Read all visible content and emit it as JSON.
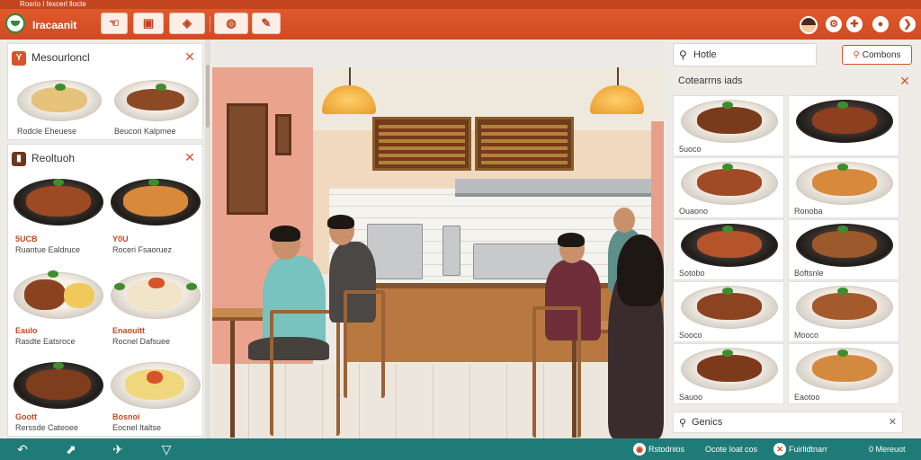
{
  "window": {
    "title": "Rosrio l fexcerl llocte"
  },
  "toolbar": {
    "app_title": "Iracaanit",
    "buttons": [
      {
        "name": "toolbar-btn-1",
        "icon": "hand-icon",
        "glyph": "☜"
      },
      {
        "name": "toolbar-btn-2",
        "icon": "receipt-icon",
        "glyph": "▣"
      },
      {
        "name": "toolbar-btn-3",
        "icon": "tag-icon",
        "glyph": "◈"
      },
      {
        "name": "toolbar-btn-4",
        "icon": "bowl-icon",
        "glyph": "◍"
      },
      {
        "name": "toolbar-btn-5",
        "icon": "edit-icon",
        "glyph": "✎"
      }
    ],
    "right_icons": [
      {
        "name": "settings-round-button",
        "icon": "gear-icon",
        "glyph": "⚙"
      },
      {
        "name": "info-round-button",
        "icon": "plus-icon",
        "glyph": "✚"
      },
      {
        "name": "alerts-round-button",
        "icon": "bell-icon",
        "glyph": "●"
      },
      {
        "name": "next-round-button",
        "icon": "arrow-right-icon",
        "glyph": "❯"
      }
    ]
  },
  "left_panel": {
    "top_card": {
      "title": "Mesourloncl",
      "icon_glyph": "Y",
      "items": [
        {
          "name": "Rodcle Eheuese",
          "food": "#e6c27a"
        },
        {
          "name": "Beucori Kalpmee",
          "food": "#8b4a23"
        }
      ]
    },
    "main_card": {
      "title": "Reoltuoh",
      "items": [
        {
          "price": "5UCB",
          "name": "Ruantue Ealdruce",
          "food": "#9b4a22",
          "plate": "dark"
        },
        {
          "price": "Y0U",
          "name": "Roceri Fsaoruez",
          "food": "#d88a3a",
          "plate": "dark"
        },
        {
          "price": "Eaulo",
          "name": "Rasdte Eatsroce",
          "food": "#8a4320",
          "plate": "light"
        },
        {
          "price": "Enaouitt",
          "name": "Rocnel Dafsuee",
          "food": "#f1e4c8",
          "plate": "light"
        },
        {
          "price": "Goott",
          "name": "Rerssde Cateoee",
          "food": "#7e3d1d",
          "plate": "dark"
        },
        {
          "price": "Bosnoi",
          "name": "Eocnel Italtse",
          "food": "#f0d77e",
          "plate": "light"
        }
      ]
    }
  },
  "right_panel": {
    "search": {
      "value": "Hotle"
    },
    "search_button": "Combons",
    "card_title": "Cotearrns iads",
    "items": [
      {
        "price": "5uoco",
        "food": "#7a3b1c",
        "plate": "light"
      },
      {
        "price": "",
        "food": "#8d3f1f",
        "plate": "dark"
      },
      {
        "price": "Ouaono",
        "food": "#a04b24",
        "plate": "light"
      },
      {
        "price": "Ronoba",
        "food": "#d78a3b",
        "plate": "light"
      },
      {
        "price": "Sotobo",
        "food": "#b5532a",
        "plate": "dark"
      },
      {
        "price": "Boftsnle",
        "food": "#9c5a2c",
        "plate": "dark"
      },
      {
        "price": "Sooco",
        "food": "#8b4321",
        "plate": "light"
      },
      {
        "price": "Mooco",
        "food": "#a55a2e",
        "plate": "light"
      },
      {
        "price": "Sauoo",
        "food": "#7d3a1b",
        "plate": "light"
      },
      {
        "price": "Eaotoo",
        "food": "#d48a3e",
        "plate": "light"
      },
      {
        "price": "",
        "food": "#b25a2a",
        "plate": "dark"
      },
      {
        "price": "",
        "food": "#8f3c1c",
        "plate": "light"
      }
    ],
    "footer_label": "Genics"
  },
  "bottom_bar": {
    "left_icons": [
      {
        "name": "back-icon",
        "glyph": "↶"
      },
      {
        "name": "export-icon",
        "glyph": "⬈"
      },
      {
        "name": "rocket-icon",
        "glyph": "✈"
      },
      {
        "name": "filter-icon",
        "glyph": "▽"
      }
    ],
    "statuses": [
      {
        "label": "Rstodnios",
        "glyph": "◉"
      },
      {
        "label": "Ocote Ioat cos",
        "glyph": ""
      },
      {
        "label": "Fuirlidtnarr",
        "glyph": "✕"
      },
      {
        "label": "0 Mereuot",
        "glyph": ""
      }
    ]
  },
  "colors": {
    "accent": "#d9532a",
    "teal": "#1f7b78",
    "background": "#eceae6"
  }
}
